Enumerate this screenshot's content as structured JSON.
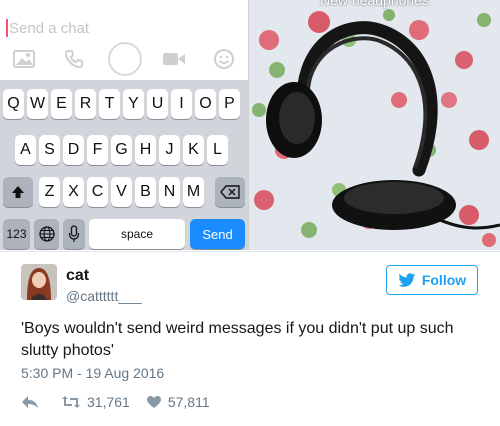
{
  "chat": {
    "placeholder": "Send a chat",
    "icons": [
      "image-icon",
      "phone-icon",
      "camera-button",
      "video-icon",
      "emoji-icon"
    ]
  },
  "keyboard": {
    "row1": [
      "Q",
      "W",
      "E",
      "R",
      "T",
      "Y",
      "U",
      "I",
      "O",
      "P"
    ],
    "row2": [
      "A",
      "S",
      "D",
      "F",
      "G",
      "H",
      "J",
      "K",
      "L"
    ],
    "row3": [
      "Z",
      "X",
      "C",
      "V",
      "B",
      "N",
      "M"
    ],
    "numbers_label": "123",
    "space_label": "space",
    "send_label": "Send"
  },
  "photo": {
    "caption": "New headphones"
  },
  "tweet": {
    "name": "cat",
    "handle": "@catttttt___",
    "follow_label": "Follow",
    "text": "'Boys wouldn't send weird messages if you didn't put up such slutty photos'",
    "timestamp": "5:30 PM - 19 Aug 2016",
    "retweets": "31,761",
    "likes": "57,811"
  },
  "colors": {
    "twitter_blue": "#1da1f2",
    "send_blue": "#1a8cff",
    "caret_pink": "#ff4f6e"
  }
}
